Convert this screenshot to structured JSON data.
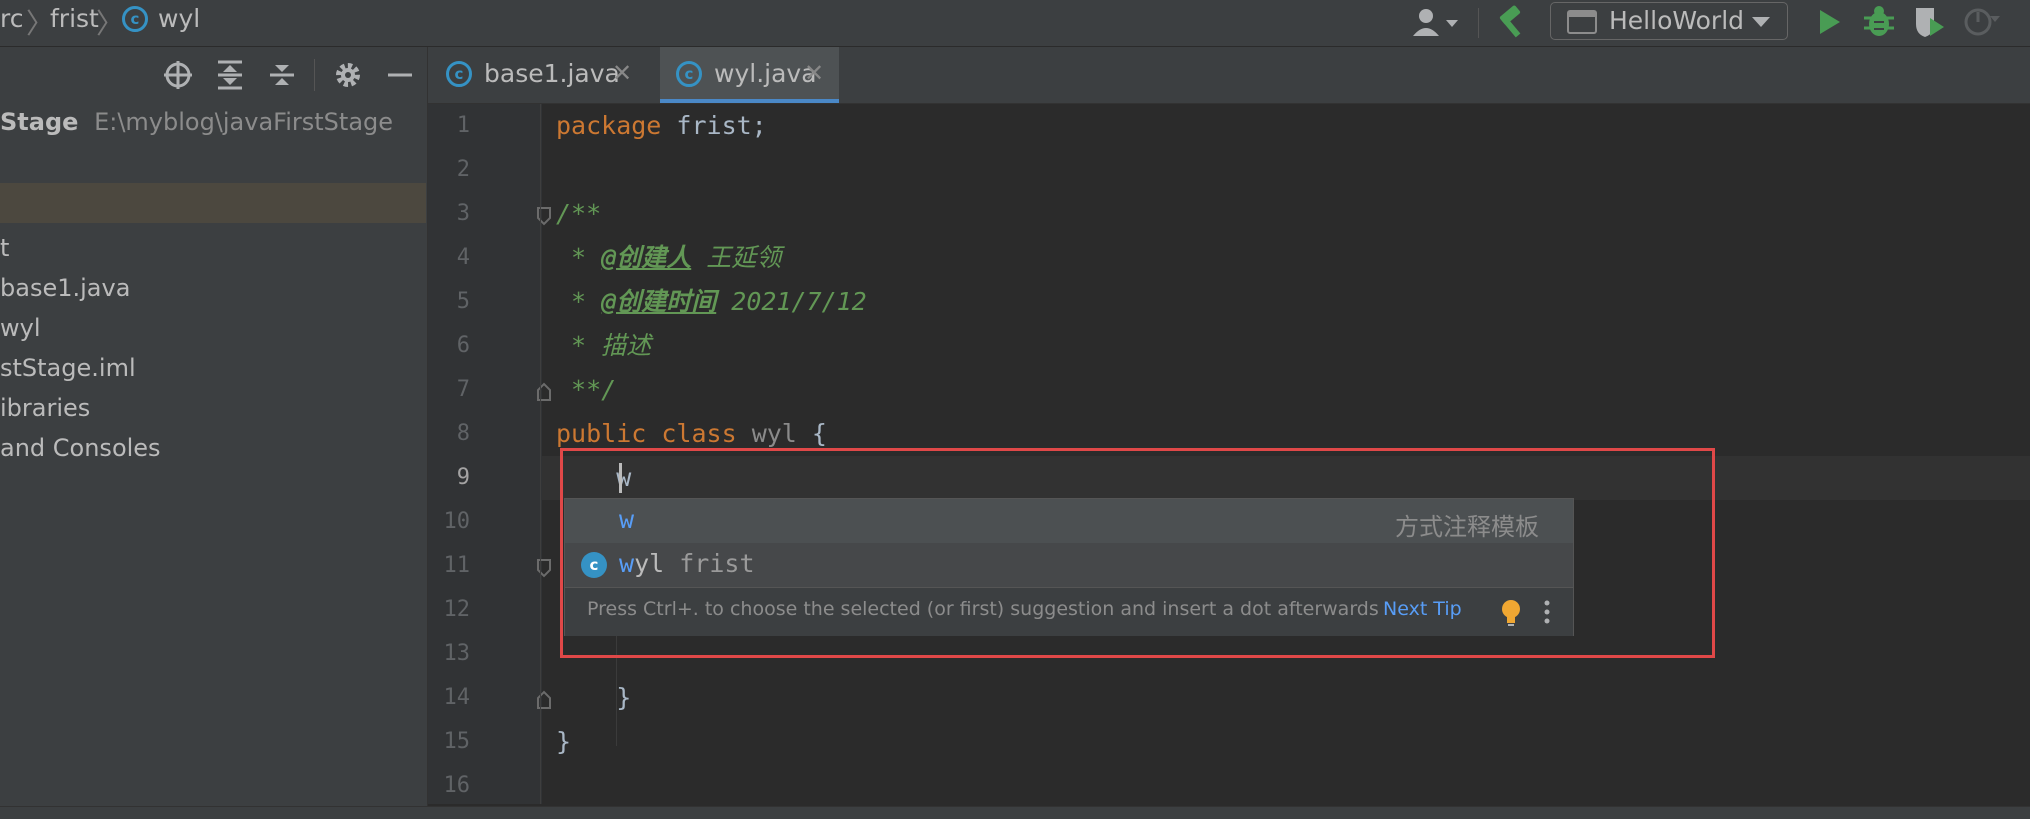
{
  "breadcrumb": {
    "items": [
      "rc",
      "frist",
      "wyl"
    ]
  },
  "toolbar": {
    "run_config": "HelloWorld"
  },
  "project": {
    "root_name": "Stage",
    "root_path": "E:\\myblog\\javaFirstStage",
    "tree": [
      {
        "label": "t"
      },
      {
        "label": "base1.java"
      },
      {
        "label": "wyl"
      },
      {
        "label": "stStage.iml"
      },
      {
        "label": "ibraries"
      },
      {
        "label": " and Consoles"
      }
    ]
  },
  "tabs": [
    {
      "label": "base1.java",
      "active": false
    },
    {
      "label": "wyl.java",
      "active": true
    }
  ],
  "editor": {
    "line_numbers": [
      "1",
      "2",
      "3",
      "4",
      "5",
      "6",
      "7",
      "8",
      "9",
      "10",
      "11",
      "12",
      "13",
      "14",
      "15",
      "16"
    ],
    "current_line": "9",
    "lines": {
      "l1_kw": "package",
      "l1_rest": " frist;",
      "l3": "/**",
      "l4_star": " * ",
      "l4_tag": "@创建人",
      "l4_text": " 王延领",
      "l5_star": " * ",
      "l5_tag": "@创建时间",
      "l5_text": " 2021/7/12",
      "l6": " * 描述",
      "l7": " **/",
      "l8_kw1": "public",
      "l8_kw2": "class",
      "l8_name": "wyl",
      "l8_brace": "{",
      "l9": "    w",
      "l14": "    }",
      "l15": "}"
    }
  },
  "completion": {
    "item1_match": "w",
    "item1_hint": "方式注释模板",
    "item2_match": "w",
    "item2_rest": "yl",
    "item2_pkg": "frist",
    "footer_tip": "Press Ctrl+. to choose the selected (or first) suggestion and insert a dot afterwards",
    "next_tip": "Next Tip"
  },
  "colors": {
    "accent_blue": "#4a88c7",
    "highlight_red": "#e04848",
    "run_green": "#499c54"
  }
}
